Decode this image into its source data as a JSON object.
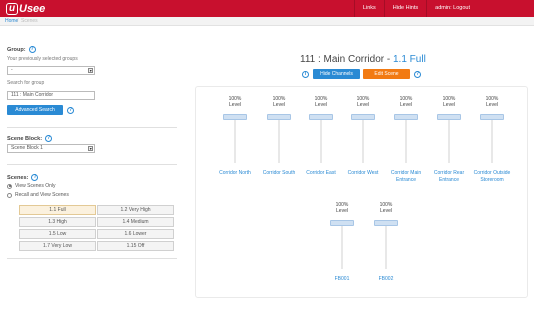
{
  "app": {
    "logo_text": "Usee",
    "brand_color": "#c8102e",
    "accent_color": "#2a8ad4"
  },
  "nav": {
    "links": [
      "Links",
      "Hide Hints",
      "admin: Logout"
    ]
  },
  "breadcrumb": {
    "home": "Home",
    "separator": "/",
    "current": "Scenes"
  },
  "group": {
    "title": "Group:",
    "subtitle": "Your previously selected groups",
    "select_value": "-",
    "search_label": "Search for group",
    "search_value": "111 : Main Corridor",
    "advanced_search": "Advanced Search"
  },
  "scene_block": {
    "title": "Scene Block:",
    "select_value": "Scene Block 1"
  },
  "scenes": {
    "title": "Scenes:",
    "options": [
      "View Scenes Only",
      "Recall and View Scenes"
    ],
    "selected_option": "View Scenes Only",
    "buttons": [
      "1.1 Full",
      "1.2 Very High",
      "1.3 High",
      "1.4 Medium",
      "1.5 Low",
      "1.6 Lower",
      "1.7 Very Low",
      "1.15 Off"
    ],
    "active_button": "1.1 Full"
  },
  "main": {
    "title": "111 : Main Corridor -",
    "scene": "1.1 Full",
    "hide_channels": "Hide Channels",
    "edit_scene": "Edit Scene"
  },
  "channels": [
    {
      "percent": "100%",
      "level_label": "Level",
      "name": "Corridor North",
      "level": 1.0
    },
    {
      "percent": "100%",
      "level_label": "Level",
      "name": "Corridor South",
      "level": 1.0
    },
    {
      "percent": "100%",
      "level_label": "Level",
      "name": "Corridor East",
      "level": 1.0
    },
    {
      "percent": "100%",
      "level_label": "Level",
      "name": "Corridor West",
      "level": 1.0
    },
    {
      "percent": "100%",
      "level_label": "Level",
      "name": "Corridor Main Entrance",
      "level": 1.0
    },
    {
      "percent": "100%",
      "level_label": "Level",
      "name": "Corridor Rear Entrance",
      "level": 1.0
    },
    {
      "percent": "100%",
      "level_label": "Level",
      "name": "Corridor Outside Storeroom",
      "level": 1.0
    },
    {
      "percent": "100%",
      "level_label": "Level",
      "name": "FB001",
      "level": 1.0
    },
    {
      "percent": "100%",
      "level_label": "Level",
      "name": "FB002",
      "level": 1.0
    }
  ]
}
